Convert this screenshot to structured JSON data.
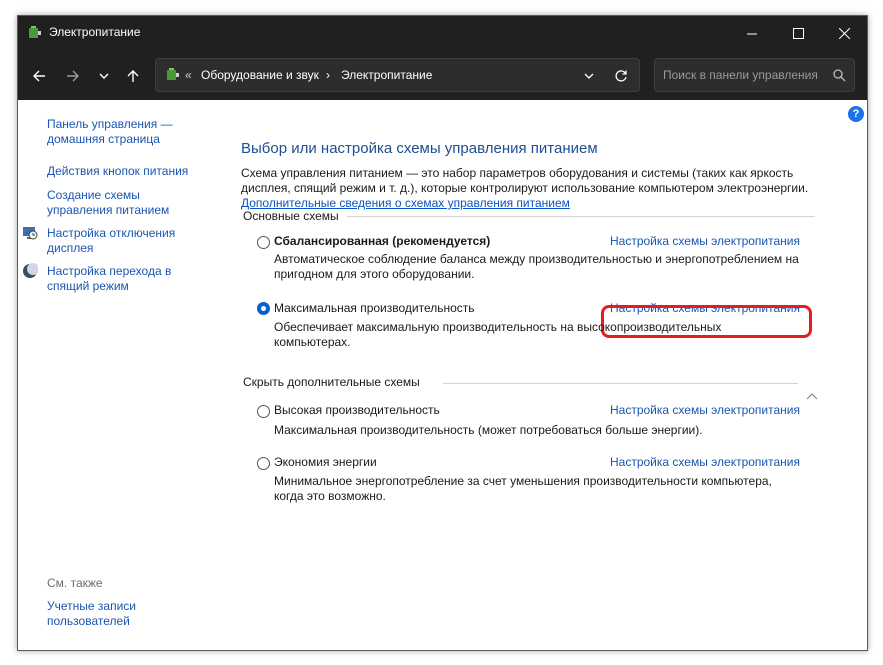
{
  "window": {
    "title": "Электропитание",
    "controls": {
      "minimize": "minimize-icon",
      "maximize": "maximize-icon",
      "close": "close-icon"
    }
  },
  "navigation": {
    "breadcrumb_prefix": "«",
    "breadcrumb": [
      "Оборудование и звук",
      "Электропитание"
    ],
    "separator": "›",
    "search_placeholder": "Поиск в панели управления"
  },
  "sidebar": {
    "items": [
      {
        "label": "Панель управления — домашняя страница",
        "icon": ""
      },
      {
        "label": "Действия кнопок питания",
        "icon": ""
      },
      {
        "label": "Создание схемы управления питанием",
        "icon": ""
      },
      {
        "label": "Настройка отключения дисплея",
        "icon": "monitor-clock-icon"
      },
      {
        "label": "Настройка перехода в спящий режим",
        "icon": "moon-icon"
      }
    ],
    "see_also_title": "См. также",
    "see_also_items": [
      {
        "label": "Учетные записи пользователей"
      }
    ]
  },
  "main": {
    "heading": "Выбор или настройка схемы управления питанием",
    "intro": "Схема управления питанием — это набор параметров оборудования и системы (таких как яркость дисплея, спящий режим и т. д.), которые контролируют использование компьютером электроэнергии.",
    "intro_link": "Дополнительные сведения о схемах управления питанием",
    "basic_section": "Основные схемы",
    "hidden_section": "Скрыть дополнительные схемы",
    "plans": [
      {
        "name": "Сбалансированная (рекомендуется)",
        "desc": "Автоматическое соблюдение баланса между производительностью и энергопотреблением на пригодном для этого оборудовании.",
        "link": "Настройка схемы электропитания",
        "selected": false
      },
      {
        "name": "Максимальная производительность",
        "desc": "Обеспечивает максимальную производительность на высокопроизводительных компьютерах.",
        "link": "Настройка схемы электропитания",
        "selected": true
      },
      {
        "name": "Высокая производительность",
        "desc": "Максимальная производительность (может потребоваться больше энергии).",
        "link": "Настройка схемы электропитания",
        "selected": false
      },
      {
        "name": "Экономия энергии",
        "desc": "Минимальное энергопотребление за счет уменьшения производительности компьютера, когда это возможно.",
        "link": "Настройка схемы электропитания",
        "selected": false
      }
    ]
  },
  "colors": {
    "titlebar": "#202020",
    "link": "#1a56b0",
    "heading": "#1d4f91",
    "highlight": "#e41e1e",
    "radio_selected": "#0a5fd0"
  }
}
